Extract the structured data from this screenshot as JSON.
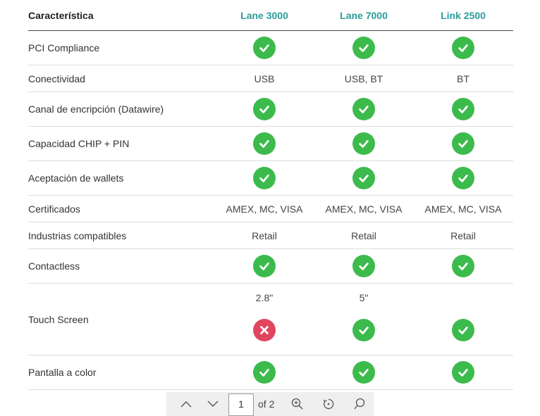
{
  "colors": {
    "accent": "#2a9d9a",
    "check": "#3cbb4c",
    "cross": "#e0475e",
    "pager_bg": "#efefef"
  },
  "table": {
    "header": {
      "feature": "Característica",
      "products": [
        "Lane 3000",
        "Lane 7000",
        "Link 2500"
      ]
    },
    "rows": [
      {
        "label": "PCI Compliance",
        "values": [
          {
            "icon": "check-icon"
          },
          {
            "icon": "check-icon"
          },
          {
            "icon": "check-icon"
          }
        ]
      },
      {
        "label": "Conectividad",
        "values": [
          {
            "text": "USB"
          },
          {
            "text": "USB, BT"
          },
          {
            "text": "BT"
          }
        ]
      },
      {
        "label": "Canal de encripción (Datawire)",
        "values": [
          {
            "icon": "check-icon"
          },
          {
            "icon": "check-icon"
          },
          {
            "icon": "check-icon"
          }
        ]
      },
      {
        "label": "Capacidad CHIP + PIN",
        "values": [
          {
            "icon": "check-icon"
          },
          {
            "icon": "check-icon"
          },
          {
            "icon": "check-icon"
          }
        ]
      },
      {
        "label": "Aceptación de wallets",
        "values": [
          {
            "icon": "check-icon"
          },
          {
            "icon": "check-icon"
          },
          {
            "icon": "check-icon"
          }
        ]
      },
      {
        "label": "Certificados",
        "values": [
          {
            "text": "AMEX, MC, VISA"
          },
          {
            "text": "AMEX, MC, VISA"
          },
          {
            "text": "AMEX, MC, VISA"
          }
        ]
      },
      {
        "label": "Industrias compatibles",
        "values": [
          {
            "text": "Retail"
          },
          {
            "text": "Retail"
          },
          {
            "text": "Retail"
          }
        ]
      },
      {
        "label": "Contactless",
        "values": [
          {
            "icon": "check-icon"
          },
          {
            "icon": "check-icon"
          },
          {
            "icon": "check-icon"
          }
        ]
      },
      {
        "label": "Touch Screen",
        "values": [
          {
            "text": "2.8\"",
            "icon": "cross-icon"
          },
          {
            "text": "5\"",
            "icon": "check-icon"
          },
          {
            "text": "",
            "icon": "check-icon"
          }
        ]
      },
      {
        "label": "Pantalla a color",
        "values": [
          {
            "icon": "check-icon"
          },
          {
            "icon": "check-icon"
          },
          {
            "icon": "check-icon"
          }
        ]
      }
    ]
  },
  "pager": {
    "page": "1",
    "of_label": "of 2",
    "buttons": [
      "chevron-up-icon",
      "chevron-down-icon",
      "zoom-in-icon",
      "rotate-icon",
      "search-icon"
    ]
  }
}
